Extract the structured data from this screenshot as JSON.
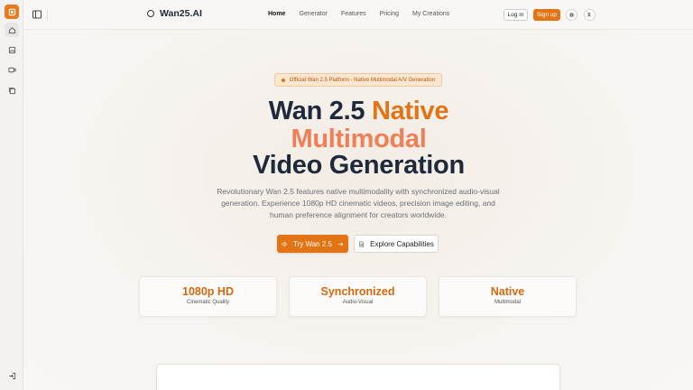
{
  "rail": {
    "items": [
      {
        "name": "logo",
        "icon": "app-logo-icon"
      },
      {
        "name": "home",
        "icon": "home-icon"
      },
      {
        "name": "image",
        "icon": "image-icon"
      },
      {
        "name": "video",
        "icon": "video-icon"
      },
      {
        "name": "gallery",
        "icon": "gallery-icon"
      },
      {
        "name": "login",
        "icon": "login-icon"
      }
    ]
  },
  "header": {
    "brand": "Wan25.AI",
    "nav": [
      {
        "label": "Home",
        "active": true
      },
      {
        "label": "Generator",
        "active": false
      },
      {
        "label": "Features",
        "active": false
      },
      {
        "label": "Pricing",
        "active": false
      },
      {
        "label": "My Creations",
        "active": false
      }
    ],
    "login_label": "Log in",
    "signup_label": "Sign up"
  },
  "hero": {
    "badge": "Official Wan 2.5 Platform - Native Multimodal A/V Generation",
    "title_part1": "Wan 2.5 ",
    "title_part1_accent": "Native",
    "title_line2": "Multimodal",
    "title_line3": "Video Generation",
    "description": "Revolutionary Wan 2.5 features native multimodality with synchronized audio-visual generation. Experience 1080p HD cinematic videos, precision image editing, and human preference alignment for creators worldwide.",
    "primary_cta": "Try Wan 2.5",
    "secondary_cta": "Explore Capabilities"
  },
  "stats": [
    {
      "value": "1080p HD",
      "label": "Cinematic Quality"
    },
    {
      "value": "Synchronized",
      "label": "Audio-Visual"
    },
    {
      "value": "Native",
      "label": "Multimodal"
    }
  ],
  "colors": {
    "accent": "#e37416",
    "accent_light": "#f07f56",
    "heading": "#1e2a3b"
  }
}
